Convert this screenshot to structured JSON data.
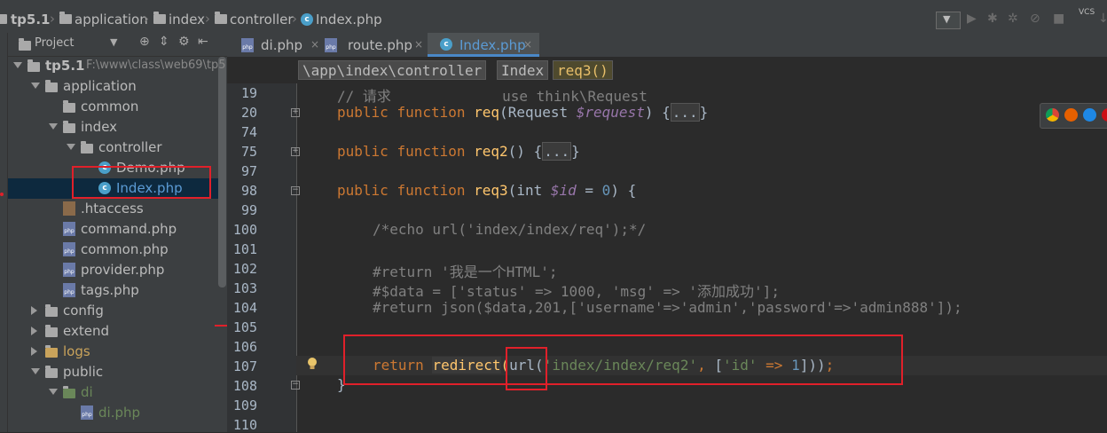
{
  "nav": {
    "project": "tp5.1",
    "crumbs": [
      "application",
      "index",
      "controller",
      "Index.php"
    ]
  },
  "project_panel": {
    "title": "Project",
    "tree": [
      {
        "label": "tp5.1",
        "extra": "F:\\www\\class\\web69\\tp5",
        "depth": 0,
        "expanded": true,
        "kind": "folder"
      },
      {
        "label": "application",
        "depth": 1,
        "expanded": true,
        "kind": "folder"
      },
      {
        "label": "common",
        "depth": 2,
        "kind": "folder"
      },
      {
        "label": "index",
        "depth": 2,
        "expanded": true,
        "kind": "folder"
      },
      {
        "label": "controller",
        "depth": 3,
        "expanded": true,
        "kind": "folder"
      },
      {
        "label": "Demo.php",
        "depth": 4,
        "kind": "class"
      },
      {
        "label": "Index.php",
        "depth": 4,
        "kind": "class",
        "selected": true
      },
      {
        "label": ".htaccess",
        "depth": 2,
        "kind": "file"
      },
      {
        "label": "command.php",
        "depth": 2,
        "kind": "php"
      },
      {
        "label": "common.php",
        "depth": 2,
        "kind": "php"
      },
      {
        "label": "provider.php",
        "depth": 2,
        "kind": "php"
      },
      {
        "label": "tags.php",
        "depth": 2,
        "kind": "php"
      },
      {
        "label": "config",
        "depth": 1,
        "expanded": false,
        "kind": "folder"
      },
      {
        "label": "extend",
        "depth": 1,
        "expanded": false,
        "kind": "folder"
      },
      {
        "label": "logs",
        "depth": 1,
        "expanded": false,
        "kind": "folder",
        "color": "#c9a35b"
      },
      {
        "label": "public",
        "depth": 1,
        "expanded": true,
        "kind": "folder"
      },
      {
        "label": "di",
        "depth": 2,
        "expanded": true,
        "kind": "folder",
        "color": "#6a8759"
      },
      {
        "label": "di.php",
        "depth": 3,
        "kind": "php",
        "color": "#6a8759"
      }
    ]
  },
  "tabs": [
    {
      "label": "di.php",
      "active": false
    },
    {
      "label": "route.php",
      "active": false
    },
    {
      "label": "Index.php",
      "active": true
    }
  ],
  "editor_breadcrumbs": [
    "\\app\\index\\controller",
    "Index",
    "req3()"
  ],
  "code": {
    "line_numbers": [
      "19",
      "20",
      "74",
      "75",
      "97",
      "98",
      "99",
      "100",
      "101",
      "102",
      "103",
      "104",
      "105",
      "106",
      "107",
      "108",
      "109",
      "110"
    ],
    "l19_comment": "// 请求             use think\\Request",
    "kw_public": "public",
    "kw_function": "function",
    "fn_req": "req",
    "fn_req2": "req2",
    "fn_req3": "req3",
    "cls_request": "Request",
    "var_request": "$request",
    "kw_int": "int",
    "var_id": "$id",
    "num_zero": "0",
    "fold_dots": "...",
    "l100": "/*echo url('index/index/req');*/",
    "l102": "#return '我是一个HTML';",
    "l103": "#$data = ['status' => 1000, 'msg' => '添加成功'];",
    "l104": "#return json($data,201,['username'=>'admin','password'=>'admin888']);",
    "kw_return": "return",
    "fn_redirect": "redirect",
    "fn_url": "url",
    "str_route": "'index/index/req2'",
    "str_id": "'id'",
    "op_arrow": "=>",
    "num_one": "1",
    "brace_close": "}"
  },
  "colors": {
    "keyword": "#cc7832",
    "function": "#ffc66d",
    "string": "#6a8759",
    "number": "#6897bb",
    "comment": "#808080",
    "annotation_box": "#e0202a"
  }
}
